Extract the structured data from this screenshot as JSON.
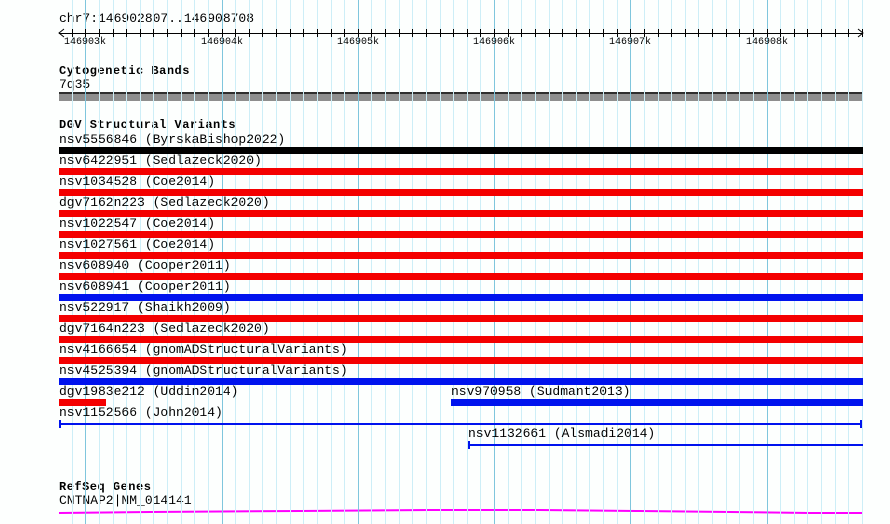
{
  "region": {
    "title": "chr7:146902807..146908708",
    "chromosome": "chr7",
    "start": 146902807,
    "end": 146908708
  },
  "ruler": {
    "minor_step": 100,
    "major_step": 1000,
    "labels": [
      {
        "text": "146903k",
        "pos": 146903000
      },
      {
        "text": "146904k",
        "pos": 146904000
      },
      {
        "text": "146905k",
        "pos": 146905000
      },
      {
        "text": "146906k",
        "pos": 146906000
      },
      {
        "text": "146907k",
        "pos": 146907000
      },
      {
        "text": "146908k",
        "pos": 146908000
      }
    ]
  },
  "colors": {
    "bg": "#fdfffe",
    "grid_minor": "#cdeef7",
    "grid_major": "#7fc6dd",
    "red": "#f40000",
    "blue": "#0013ee",
    "black": "#000000",
    "band_body": "#8e8e8e",
    "band_edge": "#2e2e2e",
    "magenta": "#ff00ff",
    "axis": "#000000"
  },
  "sections": {
    "cytogenetic": {
      "header": "Cytogenetic Bands",
      "band_label": "7q35"
    },
    "dgv": {
      "header": "DGV Structural Variants",
      "tracks": [
        {
          "row": 0,
          "label": "nsv5556846 (ByrskaBishop2022)",
          "glyph": "box",
          "color": "black",
          "x1f": 0,
          "x2f": 1
        },
        {
          "row": 1,
          "label": "nsv6422951 (Sedlazeck2020)",
          "glyph": "box",
          "color": "red",
          "x1f": 0,
          "x2f": 1
        },
        {
          "row": 2,
          "label": "nsv1034528 (Coe2014)",
          "glyph": "box",
          "color": "red",
          "x1f": 0,
          "x2f": 1
        },
        {
          "row": 3,
          "label": "dgv7162n223 (Sedlazeck2020)",
          "glyph": "box",
          "color": "red",
          "x1f": 0,
          "x2f": 1
        },
        {
          "row": 4,
          "label": "nsv1022547 (Coe2014)",
          "glyph": "box",
          "color": "red",
          "x1f": 0,
          "x2f": 1
        },
        {
          "row": 5,
          "label": "nsv1027561 (Coe2014)",
          "glyph": "box",
          "color": "red",
          "x1f": 0,
          "x2f": 1
        },
        {
          "row": 6,
          "label": "nsv608940 (Cooper2011)",
          "glyph": "box",
          "color": "red",
          "x1f": 0,
          "x2f": 1
        },
        {
          "row": 7,
          "label": "nsv608941 (Cooper2011)",
          "glyph": "box",
          "color": "blue",
          "x1f": 0,
          "x2f": 1
        },
        {
          "row": 8,
          "label": "nsv522917 (Shaikh2009)",
          "glyph": "box",
          "color": "red",
          "x1f": 0,
          "x2f": 1
        },
        {
          "row": 9,
          "label": "dgv7164n223 (Sedlazeck2020)",
          "glyph": "box",
          "color": "red",
          "x1f": 0,
          "x2f": 1
        },
        {
          "row": 10,
          "label": "nsv4166654 (gnomADStructuralVariants)",
          "glyph": "box",
          "color": "red",
          "x1f": 0,
          "x2f": 1
        },
        {
          "row": 11,
          "label": "nsv4525394 (gnomADStructuralVariants)",
          "glyph": "box",
          "color": "blue",
          "x1f": 0,
          "x2f": 1
        },
        {
          "row": 12,
          "label": "dgv1983e212 (Uddin2014)",
          "glyph": "box",
          "color": "red",
          "x1f": 0,
          "x2f": 0.0585
        },
        {
          "row": 12,
          "label": "nsv970958 (Sudmant2013)",
          "glyph": "box",
          "color": "blue",
          "x1f": 0.4876,
          "x2f": 1,
          "label_at_start": true
        },
        {
          "row": 13,
          "label": "nsv1152566 (John2014)",
          "glyph": "line",
          "color": "blue",
          "x1f": 0,
          "x2f": 0.9975,
          "tick_start": true,
          "tick_end": true
        },
        {
          "row": 14,
          "label": "nsv1132661 (Alsmadi2014)",
          "glyph": "line",
          "color": "blue",
          "x1f": 0.5087,
          "x2f": 1,
          "tick_start": true,
          "label_at_start": true
        }
      ]
    },
    "refseq": {
      "header": "RefSeq Genes",
      "gene_label": "CNTNAP2|NM_014141",
      "line_points": [
        [
          59,
          513
        ],
        [
          150,
          512
        ],
        [
          300,
          511
        ],
        [
          430,
          510
        ],
        [
          540,
          510
        ],
        [
          640,
          511
        ],
        [
          730,
          512
        ],
        [
          810,
          513
        ],
        [
          862,
          513
        ]
      ]
    }
  }
}
